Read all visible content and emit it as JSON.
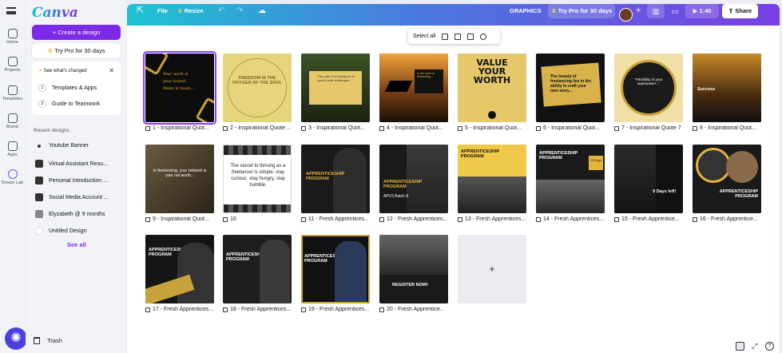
{
  "app": {
    "logo": "Canva"
  },
  "rail": [
    {
      "label": "Home"
    },
    {
      "label": "Projects"
    },
    {
      "label": "Templates"
    },
    {
      "label": "Brand"
    },
    {
      "label": "Apps"
    },
    {
      "label": "Dream Lab"
    }
  ],
  "panel": {
    "create_label": "Create a design",
    "pro_label": "Try Pro for 30 days",
    "changed_heading": "See what's changed",
    "changed_items": [
      {
        "num": "1",
        "label": "Templates & Apps"
      },
      {
        "num": "2",
        "label": "Guide to Teamwork"
      }
    ],
    "recent_heading": "Recent designs",
    "recent": [
      {
        "label": "Youtube Banner"
      },
      {
        "label": "Virtual Assistant Resu..."
      },
      {
        "label": "Personal Introduction ..."
      },
      {
        "label": "Social Media Account ..."
      },
      {
        "label": "Elyzabeth @ 9 months"
      },
      {
        "label": "Untitled Design"
      }
    ],
    "see_all": "See all",
    "trash": "Trash"
  },
  "topbar": {
    "file": "File",
    "resize": "Resize",
    "doc_title": "GRAPHICS",
    "pro": "Try Pro for 30 days",
    "plus": "+",
    "time": "1:40",
    "share": "Share"
  },
  "floatbar": {
    "select_all": "Select all"
  },
  "pages": [
    {
      "label": "1 - Inspirational Quot..."
    },
    {
      "label": "2 - Inspirational Quote ..."
    },
    {
      "label": "3 - Inspirational Quot..."
    },
    {
      "label": "4 - Inspirational Quot..."
    },
    {
      "label": "5 - Inspirational Quot..."
    },
    {
      "label": "6 - Inspirational Quot..."
    },
    {
      "label": "7 - Inspirational Quote 7"
    },
    {
      "label": "8 - Inspirational Quot..."
    },
    {
      "label": "9 - Inspirational Quot..."
    },
    {
      "label": "10"
    },
    {
      "label": "11 - Fresh Apprentices..."
    },
    {
      "label": "12 - Fresh Apprentices..."
    },
    {
      "label": "13 - Fresh Apprentices..."
    },
    {
      "label": "14 - Fresh Apprentices..."
    },
    {
      "label": "15 - Fresh Apprentice..."
    },
    {
      "label": "16 - Fresh Apprentice..."
    },
    {
      "label": "17 - Fresh Apprentices..."
    },
    {
      "label": "18 - Fresh Apprentices..."
    },
    {
      "label": "19 - Fresh Apprentices..."
    },
    {
      "label": "20 - Fresh Apprentice..."
    }
  ],
  "thumbs": {
    "t5_big": "VALUE YOUR WORTH",
    "t10_quote": "The secret to thriving as a freelancer is simple: stay curious, stay hungry, stay humble.",
    "t_program": "APPRENTICESHIP PROGRAM",
    "t_batch": "APV3 Batch 8",
    "t_days": "9 Days left!",
    "t_register": "REGISTER NOW!",
    "t_success": "Success"
  },
  "colors": {
    "accent": "#7d2ae8",
    "topbar_from": "#1ec3d2",
    "topbar_to": "#7a3fe3"
  }
}
